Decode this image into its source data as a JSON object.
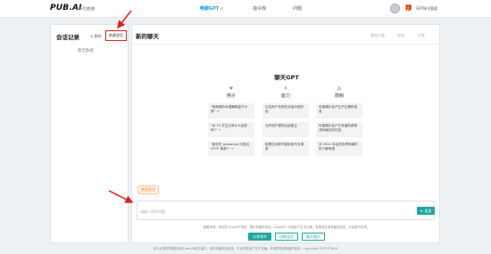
{
  "topbar": {
    "logo": "PUB.AI",
    "logo_sub": "布拉曲曲",
    "nav": [
      {
        "label": "畅聊GPT",
        "hot": "火",
        "active": true
      },
      {
        "label": "指令库",
        "active": false
      },
      {
        "label": "问题",
        "active": false
      }
    ],
    "user_link": "GPT帐号管理"
  },
  "sidebar": {
    "title": "会话记录",
    "delete_label": "删除",
    "new_label": "新建会话",
    "empty_text": "暂无数据"
  },
  "main": {
    "title": "新的聊天",
    "header_actions": [
      "清空记录",
      "导出",
      "分享"
    ],
    "chat_title": "聊天GPT",
    "columns": [
      {
        "icon": "☀",
        "heading": "例子",
        "cards": [
          "\"用简单的术语解释量子计算\" →",
          "\"对 10 岁生日有什么创意吗?\" →",
          "\"如何在 Javascript 中发出 HTTP 请求?\" →"
        ]
      },
      {
        "icon": "⚡",
        "heading": "能力",
        "cards": [
          "记住用户先前在对话中说的话",
          "允许用户提供后续更正",
          "接受过训练不能拒绝不当请求"
        ]
      },
      {
        "icon": "⚠",
        "heading": "限制",
        "cards": [
          "可能偶尔会产生不正确的信息",
          "可能偶尔会产生有害的说明或有偏见的内容",
          "对 2021 年后的世界和事件的了解有限"
        ]
      }
    ],
    "mode_tag": "普通会话",
    "input_placeholder": "请输入你的问题",
    "send_label": "发送",
    "disclaimer": "重要声明：请勿在ChatGPT发布、展示有害的信息。ChatGPT 可能会产生不正确、有误导性或有害的信息，平台概不负责。",
    "bottom_buttons": [
      "分享指令",
      "切换会话",
      "聊天图片"
    ]
  },
  "footer": "该平台提供的模型来自OpenAI官方接口，请勿传播违法信息，平台可能会产生不正确、有误导性或有害的信息，Copyright 2023 PUB.AI"
}
